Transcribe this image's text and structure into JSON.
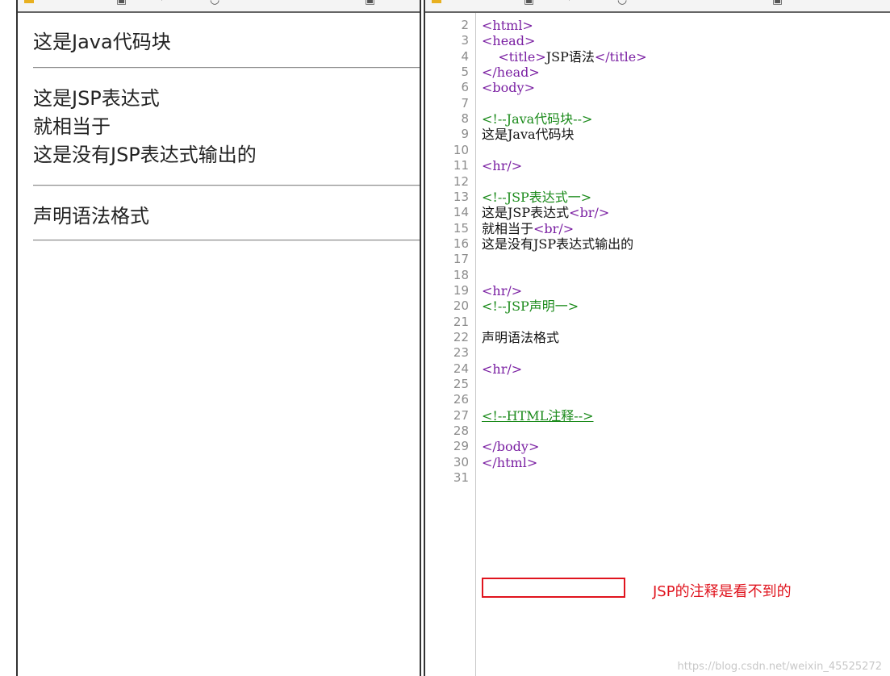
{
  "rendered_view": {
    "java_block": "这是Java代码块",
    "expr_line1": "这是JSP表达式",
    "expr_line2": "就相当于",
    "expr_line3": "这是没有JSP表达式输出的",
    "declaration": "声明语法格式"
  },
  "editor": {
    "lines": [
      {
        "n": "2",
        "tokens": [
          {
            "c": "tag",
            "t": "<html>"
          }
        ]
      },
      {
        "n": "3",
        "tokens": [
          {
            "c": "tag",
            "t": "<head>"
          }
        ]
      },
      {
        "n": "4",
        "tokens": [
          {
            "c": "txt",
            "t": "    "
          },
          {
            "c": "tag",
            "t": "<title>"
          },
          {
            "c": "txt",
            "t": "JSP语法"
          },
          {
            "c": "tag",
            "t": "</title>"
          }
        ]
      },
      {
        "n": "5",
        "tokens": [
          {
            "c": "tag",
            "t": "</head>"
          }
        ]
      },
      {
        "n": "6",
        "tokens": [
          {
            "c": "tag",
            "t": "<body>"
          }
        ]
      },
      {
        "n": "7",
        "tokens": []
      },
      {
        "n": "8",
        "tokens": [
          {
            "c": "cmt",
            "t": "<!--Java代码块-->"
          }
        ]
      },
      {
        "n": "9",
        "tokens": [
          {
            "c": "txt",
            "t": "这是Java代码块"
          }
        ]
      },
      {
        "n": "10",
        "tokens": []
      },
      {
        "n": "11",
        "tokens": [
          {
            "c": "tag",
            "t": "<hr/>"
          }
        ]
      },
      {
        "n": "12",
        "tokens": []
      },
      {
        "n": "13",
        "tokens": [
          {
            "c": "cmt",
            "t": "<!--JSP表达式一>"
          }
        ]
      },
      {
        "n": "14",
        "tokens": [
          {
            "c": "txt",
            "t": "这是JSP表达式"
          },
          {
            "c": "tag",
            "t": "<br/>"
          }
        ]
      },
      {
        "n": "15",
        "tokens": [
          {
            "c": "txt",
            "t": "就相当于"
          },
          {
            "c": "tag",
            "t": "<br/>"
          }
        ]
      },
      {
        "n": "16",
        "tokens": [
          {
            "c": "txt",
            "t": "这是没有JSP表达式输出的"
          }
        ]
      },
      {
        "n": "17",
        "tokens": []
      },
      {
        "n": "18",
        "tokens": []
      },
      {
        "n": "19",
        "tokens": [
          {
            "c": "tag",
            "t": "<hr/>"
          }
        ]
      },
      {
        "n": "20",
        "tokens": [
          {
            "c": "cmt",
            "t": "<!--JSP声明一>"
          }
        ]
      },
      {
        "n": "21",
        "tokens": []
      },
      {
        "n": "22",
        "tokens": [
          {
            "c": "txt",
            "t": "声明语法格式"
          }
        ]
      },
      {
        "n": "23",
        "tokens": []
      },
      {
        "n": "24",
        "tokens": [
          {
            "c": "tag",
            "t": "<hr/>"
          }
        ]
      },
      {
        "n": "25",
        "tokens": []
      },
      {
        "n": "26",
        "tokens": []
      },
      {
        "n": "27",
        "tokens": [
          {
            "c": "cmt-u",
            "t": "<!--HTML注释-->"
          }
        ]
      },
      {
        "n": "28",
        "tokens": []
      },
      {
        "n": "29",
        "tokens": [
          {
            "c": "tag",
            "t": "</body>"
          }
        ]
      },
      {
        "n": "30",
        "tokens": [
          {
            "c": "tag",
            "t": "</html>"
          }
        ]
      },
      {
        "n": "31",
        "tokens": []
      }
    ]
  },
  "annotation": {
    "text": "JSP的注释是看不到的",
    "color": "#e0141e"
  },
  "watermark": "https://blog.csdn.net/weixin_45525272",
  "colors": {
    "tag": "#7a1fa2",
    "comment": "#1a8a1a",
    "text": "#111111",
    "line_number": "#8c8c8c",
    "highlight": "#e0141e"
  }
}
